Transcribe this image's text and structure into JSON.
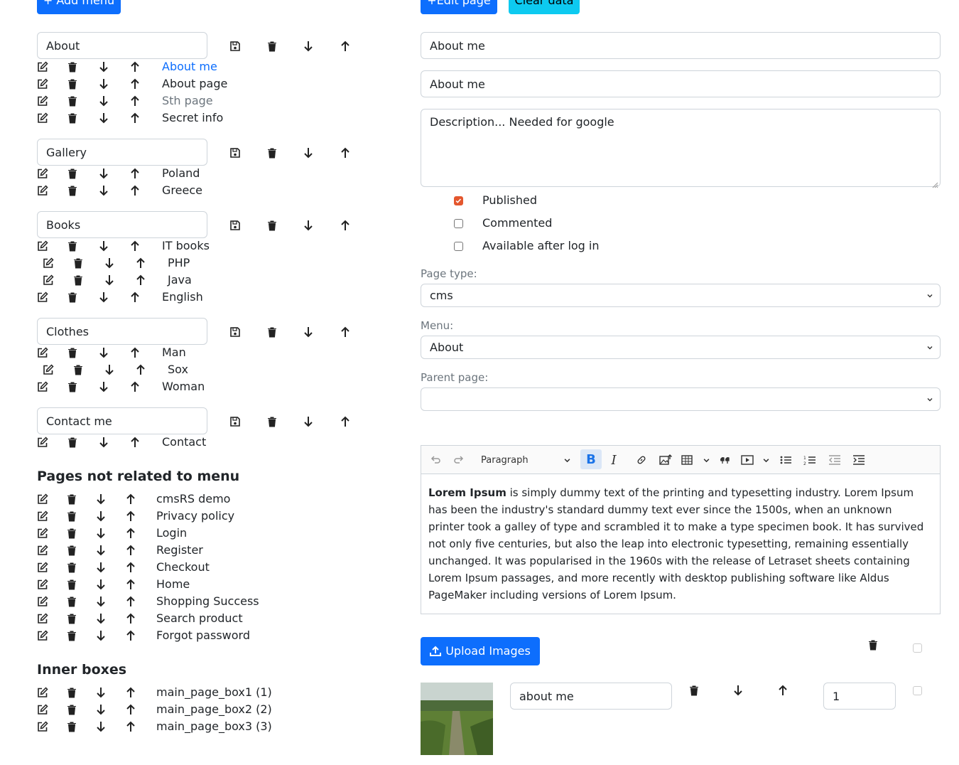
{
  "buttons": {
    "add_menu": "+ Add menu",
    "edit_page": "+Edit page",
    "clear_data": "Clear data",
    "upload_images": "Upload Images"
  },
  "menus": [
    {
      "name": "About",
      "items": [
        {
          "label": "About me",
          "state": "active"
        },
        {
          "label": "About page",
          "state": "normal"
        },
        {
          "label": "Sth page",
          "state": "muted"
        },
        {
          "label": "Secret info",
          "state": "normal"
        }
      ]
    },
    {
      "name": "Gallery",
      "items": [
        {
          "label": "Poland",
          "state": "normal"
        },
        {
          "label": "Greece",
          "state": "normal"
        }
      ]
    },
    {
      "name": "Books",
      "items": [
        {
          "label": "IT books",
          "state": "normal"
        },
        {
          "label": "PHP",
          "state": "child"
        },
        {
          "label": "Java",
          "state": "child"
        },
        {
          "label": "English",
          "state": "normal"
        }
      ]
    },
    {
      "name": "Clothes",
      "items": [
        {
          "label": "Man",
          "state": "normal"
        },
        {
          "label": "Sox",
          "state": "child"
        },
        {
          "label": "Woman",
          "state": "normal"
        }
      ]
    },
    {
      "name": "Contact me",
      "items": [
        {
          "label": "Contact",
          "state": "normal"
        }
      ]
    }
  ],
  "pages_not_related": {
    "title": "Pages not related to menu",
    "items": [
      "cmsRS demo",
      "Privacy policy",
      "Login",
      "Register",
      "Checkout",
      "Home",
      "Shopping Success",
      "Search product",
      "Forgot password"
    ]
  },
  "inner_boxes": {
    "title": "Inner boxes",
    "items": [
      "main_page_box1 (1)",
      "main_page_box2 (2)",
      "main_page_box3 (3)"
    ]
  },
  "form": {
    "title_value": "About me",
    "short_title_value": "About me",
    "description_value": "Description... Needed for google",
    "checkboxes": [
      {
        "label": "Published",
        "checked": true
      },
      {
        "label": "Commented",
        "checked": false
      },
      {
        "label": "Available after log in",
        "checked": false
      }
    ],
    "page_type_label": "Page type:",
    "page_type_value": "cms",
    "menu_label": "Menu:",
    "menu_value": "About",
    "parent_label": "Parent page:",
    "parent_value": ""
  },
  "editor": {
    "paragraph_style": "Paragraph",
    "content_bold": "Lorem Ipsum",
    "content_rest": " is simply dummy text of the printing and typesetting industry. Lorem Ipsum has been the industry's standard dummy text ever since the 1500s, when an unknown printer took a galley of type and scrambled it to make a type specimen book. It has survived not only five centuries, but also the leap into electronic typesetting, remaining essentially unchanged. It was popularised in the 1960s with the release of Letraset sheets containing Lorem Ipsum passages, and more recently with desktop publishing software like Aldus PageMaker including versions of Lorem Ipsum."
  },
  "image_row": {
    "alt_value": "about me",
    "order_value": "1"
  },
  "colors": {
    "primary": "#0d6efd",
    "info": "#0dcaf0",
    "checked": "#e4572e",
    "link_active": "#0d6efd",
    "muted": "#6c757d"
  }
}
